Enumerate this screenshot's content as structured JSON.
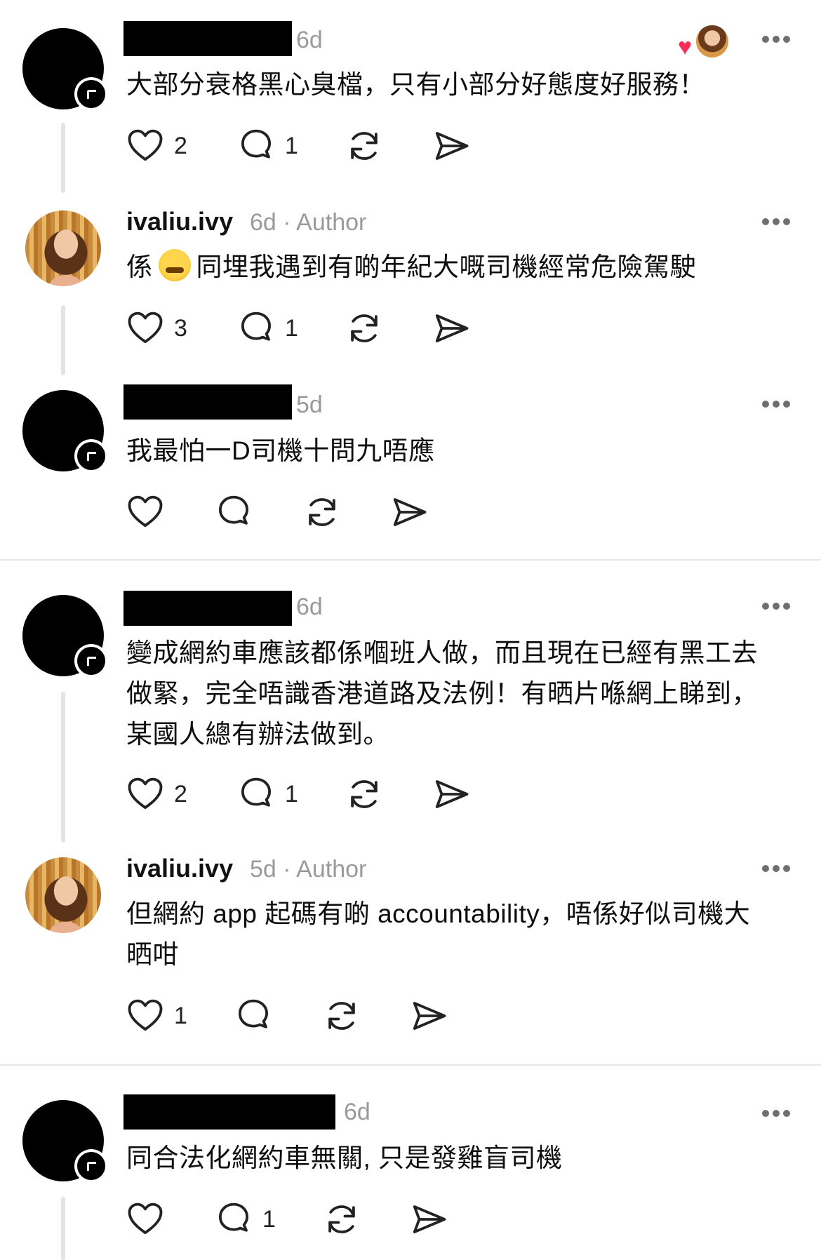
{
  "comments": [
    {
      "id": "c1",
      "user_redacted": true,
      "time": "6d",
      "text": "大部分衰格黑心臭檔，只有小部分好態度好服務！",
      "likes": "2",
      "replies": "1",
      "liked_by_author": true
    },
    {
      "id": "c2",
      "username": "ivaliu.ivy",
      "time": "6d",
      "author_label": "· Author",
      "text_before_emoji": "係",
      "emoji": "face-with-steam-from-nose",
      "text_after_emoji": "同埋我遇到有啲年紀大嘅司機經常危險駕駛",
      "likes": "3",
      "replies": "1"
    },
    {
      "id": "c3",
      "user_redacted": true,
      "time": "5d",
      "text": "我最怕一D司機十問九唔應"
    },
    {
      "id": "c4",
      "user_redacted": true,
      "time": "6d",
      "text_lines": [
        "變成網約車應該都係嗰班人做，而且現在已經有黑工去",
        "做緊，完全唔識香港道路及法例！有晒片喺網上睇到，",
        "某國人總有辦法做到。"
      ],
      "likes": "2",
      "replies": "1"
    },
    {
      "id": "c5",
      "username": "ivaliu.ivy",
      "time": "5d",
      "author_label": "· Author",
      "text_lines": [
        "但網約 app 起碼有啲 accountability，唔係好似司機大",
        "晒咁"
      ],
      "likes": "1"
    },
    {
      "id": "c6",
      "user_redacted": true,
      "time": "6d",
      "text": "同合法化網約車無關, 只是發雞盲司機",
      "replies": "1"
    }
  ],
  "icons": [
    "heart-icon",
    "comment-icon",
    "repost-icon",
    "share-icon",
    "more-icon"
  ],
  "colors": {
    "muted": "#9a9a9a",
    "thread_line": "#e3e3e3",
    "like_red": "#ff2d55"
  }
}
